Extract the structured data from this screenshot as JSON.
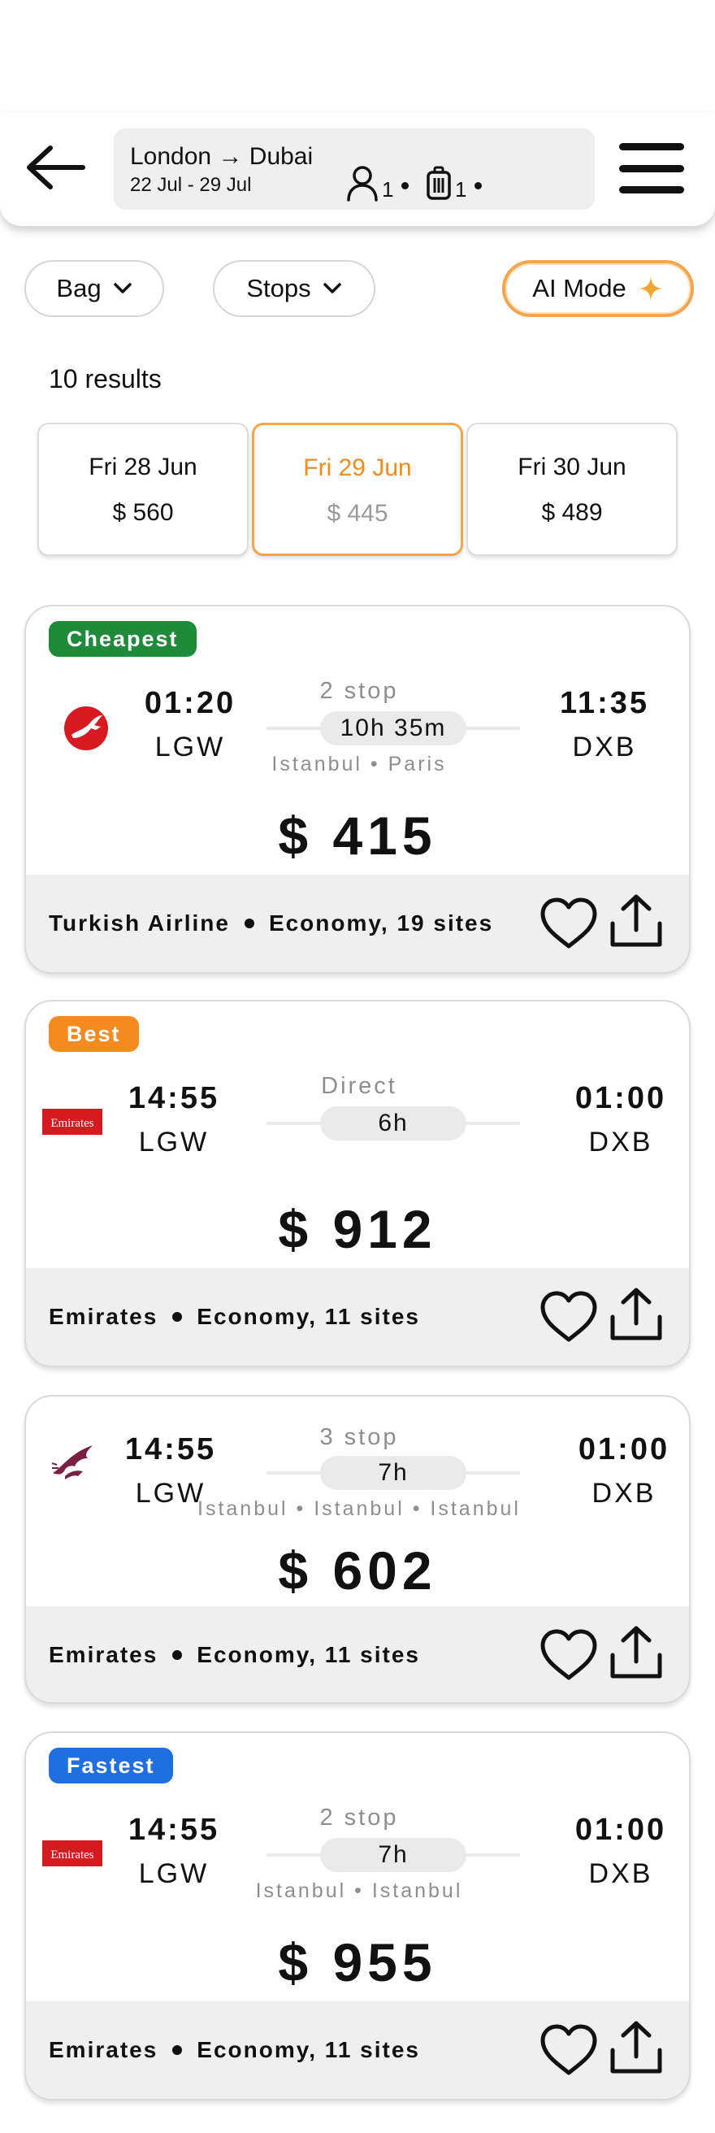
{
  "header": {
    "route": "London → Dubai",
    "dates": "22 Jul - 29 Jul",
    "passengers": "1",
    "bags": "1"
  },
  "filters": {
    "bag_label": "Bag",
    "stops_label": "Stops",
    "ai_label": "AI Mode"
  },
  "results_label": "10 results",
  "date_options": [
    {
      "date": "Fri 28 Jun",
      "price": "$ 560",
      "selected": false
    },
    {
      "date": "Fri 29 Jun",
      "price": "$ 445",
      "selected": true
    },
    {
      "date": "Fri 30 Jun",
      "price": "$ 489",
      "selected": false
    }
  ],
  "flights": [
    {
      "badge": "Cheapest",
      "badge_color": "#1e8a3a",
      "airline_logo": "turkish-airlines-logo",
      "dep_time": "01:20",
      "dep_code": "LGW",
      "stops": "2 stop",
      "duration": "10h 35m",
      "via": "Istanbul • Paris",
      "arr_time": "11:35",
      "arr_code": "DXB",
      "price": "$ 415",
      "airline": "Turkish Airline",
      "cabin": "Economy, 19 sites"
    },
    {
      "badge": "Best",
      "badge_color": "#f58a1f",
      "airline_logo": "emirates-logo",
      "dep_time": "14:55",
      "dep_code": "LGW",
      "stops": "Direct",
      "duration": "6h",
      "via": "",
      "arr_time": "01:00",
      "arr_code": "DXB",
      "price": "$ 912",
      "airline": "Emirates",
      "cabin": "Economy, 11 sites"
    },
    {
      "badge": "",
      "badge_color": "",
      "airline_logo": "qatar-airways-logo",
      "dep_time": "14:55",
      "dep_code": "LGW",
      "stops": "3 stop",
      "duration": "7h",
      "via": "Istanbul • Istanbul • Istanbul",
      "arr_time": "01:00",
      "arr_code": "DXB",
      "price": "$ 602",
      "airline": "Emirates",
      "cabin": "Economy, 11 sites"
    },
    {
      "badge": "Fastest",
      "badge_color": "#1f6fe0",
      "airline_logo": "emirates-logo",
      "dep_time": "14:55",
      "dep_code": "LGW",
      "stops": "2 stop",
      "duration": "7h",
      "via": "Istanbul • Istanbul",
      "arr_time": "01:00",
      "arr_code": "DXB",
      "price": "$ 955",
      "airline": "Emirates",
      "cabin": "Economy, 11 sites"
    }
  ],
  "logo_texts": {
    "emirates": "Emirates"
  },
  "colors": {
    "accent": "#f58a1f"
  }
}
